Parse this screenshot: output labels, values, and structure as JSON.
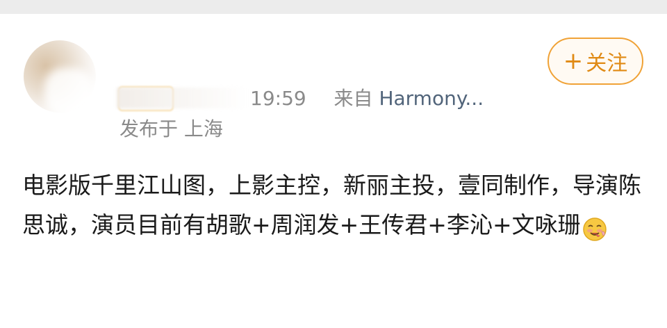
{
  "header": {
    "timestamp": "19:59",
    "source_prefix": "来自",
    "source": "Harmony..."
  },
  "location": "发布于 上海",
  "follow_button": {
    "plus": "+",
    "label": "关注"
  },
  "post": {
    "text": "电影版千里江山图，上影主控，新丽主投，壹同制作，导演陈思诚，演员目前有胡歌+周润发+王传君+李沁+文咏珊",
    "emoji": "yummy-face-emoji"
  },
  "colors": {
    "follow_accent": "#e08a14",
    "meta_gray": "#8a8a8a",
    "source_blue": "#51647a",
    "text": "#1a1a1a"
  }
}
